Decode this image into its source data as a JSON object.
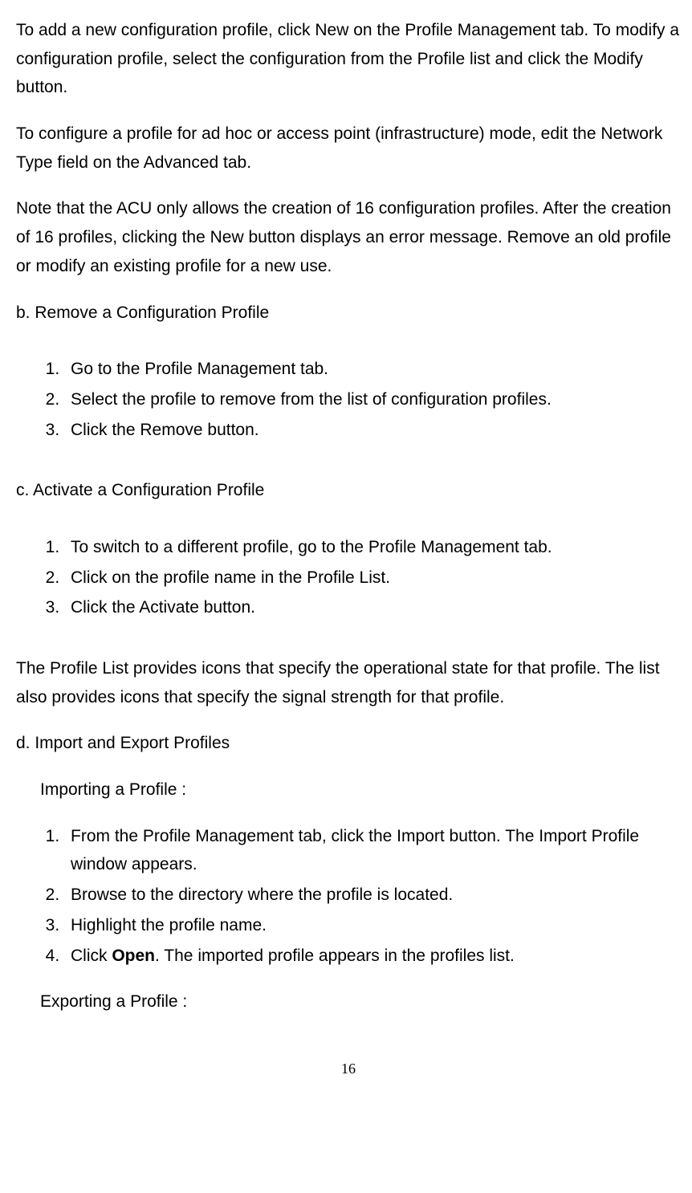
{
  "para1": "To add a new configuration profile, click New on the Profile Management tab. To modify a configuration profile, select the configuration from the Profile list and click the Modify button.",
  "para2": "To configure a profile for ad hoc or access point (infrastructure) mode, edit the Network Type field on the Advanced tab.",
  "para3": "Note that the ACU only allows the creation of 16 configuration profiles.   After the creation of 16 profiles, clicking the New button displays an error message.   Remove an old profile or modify an existing profile for a new use.",
  "heading_b": "b. Remove a Configuration Profile",
  "list_b": {
    "item1": "Go to the Profile Management tab.",
    "item2": "Select the profile to remove from the list of configuration profiles.",
    "item3": "Click the Remove button."
  },
  "heading_c": "c. Activate a Configuration Profile",
  "list_c": {
    "item1": "To switch to a different profile, go to the Profile Management tab.",
    "item2": "Click on the profile name in the Profile List.",
    "item3": "Click the Activate button."
  },
  "para_profile_list": "The Profile List provides icons that specify the operational state for that profile. The list also provides icons that specify the signal strength for that profile.",
  "heading_d": "d. Import and Export Profiles",
  "importing_heading": "Importing a Profile :",
  "list_import": {
    "item1": "From the Profile Management tab, click the Import button. The Import Profile window appears.",
    "item2": "Browse to the directory where the profile is located.",
    "item3": "Highlight the profile name.",
    "item4_prefix": "Click ",
    "item4_bold": "Open",
    "item4_suffix": ". The imported profile appears in the profiles list."
  },
  "exporting_heading": "Exporting a Profile :",
  "page_number": "16"
}
